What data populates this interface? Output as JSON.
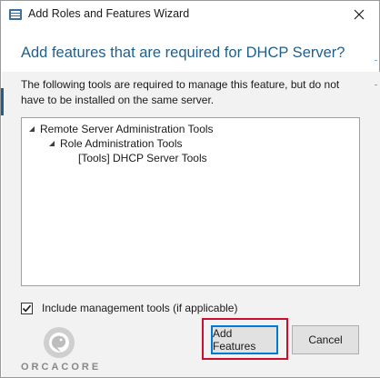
{
  "window": {
    "title": "Add Roles and Features Wizard"
  },
  "heading": "Add features that are required for DHCP Server?",
  "description": "The following tools are required to manage this feature, but do not have to be installed on the same server.",
  "tree": [
    {
      "label": "Remote Server Administration Tools",
      "expanded": true
    },
    {
      "label": "Role Administration Tools",
      "expanded": true
    },
    {
      "label": "[Tools] DHCP Server Tools",
      "expanded": false
    }
  ],
  "include_tools": {
    "label": "Include management tools (if applicable)",
    "checked": true
  },
  "buttons": {
    "add_features": "Add Features",
    "cancel": "Cancel"
  },
  "logo": {
    "text": "ORCACORE"
  },
  "colors": {
    "heading": "#1f5f8b",
    "highlight": "#c8102e",
    "default_button_border": "#0078d7"
  },
  "icons": {
    "app": "server-manager-icon",
    "close": "close-icon",
    "tree_expanded": "expanded-triangle-icon",
    "checkbox": "checkmark-icon"
  }
}
